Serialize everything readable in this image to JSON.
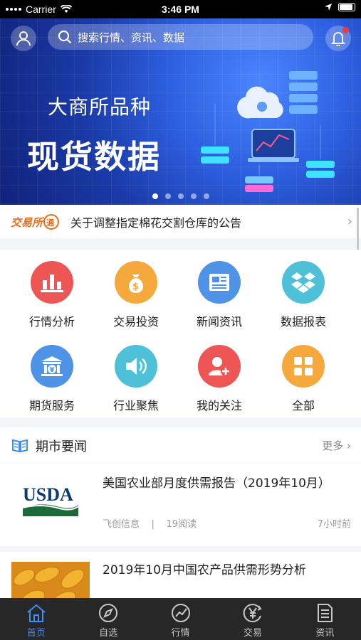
{
  "status_bar": {
    "carrier": "Carrier",
    "time": "3:46 PM"
  },
  "search": {
    "placeholder": "搜索行情、资讯、数据"
  },
  "banner": {
    "subtitle": "大商所品种",
    "title": "现货数据",
    "pages": 5,
    "active_page": 1
  },
  "notice": {
    "text": "关于调整指定棉花交割仓库的公告",
    "logo_text": "交易所通知"
  },
  "menu": {
    "items": [
      {
        "label": "行情分析",
        "icon": "bar-chart-icon",
        "color": "#ee5555"
      },
      {
        "label": "交易投资",
        "icon": "money-bag-icon",
        "color": "#f5a93c"
      },
      {
        "label": "新闻资讯",
        "icon": "newspaper-icon",
        "color": "#4f93e6"
      },
      {
        "label": "数据报表",
        "icon": "dropbox-icon",
        "color": "#4ec1d9"
      },
      {
        "label": "期货服务",
        "icon": "bank-icon",
        "color": "#4f93e6"
      },
      {
        "label": "行业聚焦",
        "icon": "speaker-icon",
        "color": "#4ec1d9"
      },
      {
        "label": "我的关注",
        "icon": "add-user-icon",
        "color": "#ee5555"
      },
      {
        "label": "全部",
        "icon": "grid-icon",
        "color": "#f5a93c"
      }
    ]
  },
  "news": {
    "section_title": "期市要闻",
    "more_label": "更多",
    "articles": [
      {
        "title": "美国农业部月度供需报告（2019年10月）",
        "source": "飞创信息",
        "reads": "19阅读",
        "time": "7小时前",
        "thumb": "USDA"
      },
      {
        "title": "2019年10月中国农产品供需形势分析",
        "thumb": "corn"
      }
    ]
  },
  "tabbar": {
    "items": [
      {
        "label": "首页",
        "icon": "home-icon",
        "active": true
      },
      {
        "label": "自选",
        "icon": "compass-icon",
        "active": false
      },
      {
        "label": "行情",
        "icon": "trend-icon",
        "active": false
      },
      {
        "label": "交易",
        "icon": "yen-icon",
        "active": false
      },
      {
        "label": "资讯",
        "icon": "document-icon",
        "active": false
      }
    ]
  },
  "colors": {
    "accent": "#3f8df5",
    "tabbar_bg": "#272727",
    "banner": "#2d5fe0"
  }
}
